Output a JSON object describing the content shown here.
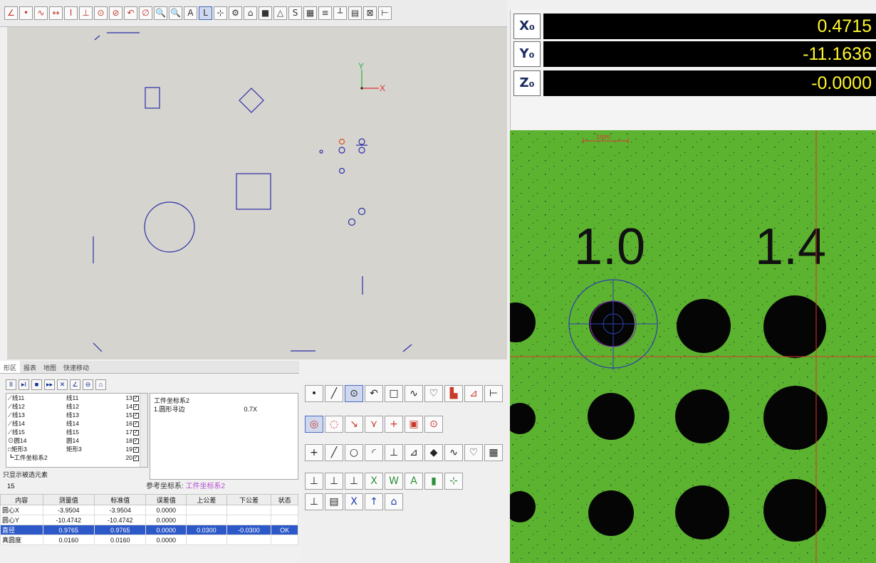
{
  "toolbar": {
    "icons": [
      "∠",
      "•",
      "∿",
      "↔",
      "I",
      "⊥",
      "⊙",
      "⊘",
      "↶",
      "∅",
      "🔍",
      "🔍",
      "A",
      "L",
      "⊹",
      "⚙",
      "⌂",
      "■",
      "△",
      "S",
      "▦",
      "≡",
      "┴",
      "▤",
      "⊠",
      "⊢"
    ]
  },
  "axes": {
    "x_label": "X",
    "y_label": "Y"
  },
  "dro": {
    "x_label": "X₀",
    "x_value": "0.4715",
    "y_label": "Y₀",
    "y_value": "-11.1636",
    "z_label": "Z₀",
    "z_value": "-0.0000"
  },
  "camera": {
    "scale_label": "1mm",
    "label_a": "1.0",
    "label_b": "1.4"
  },
  "tabs": [
    "形区",
    "报表",
    "地图",
    "快速移动"
  ],
  "controls": [
    "II",
    "▸I",
    "■",
    "▸▸",
    "✕",
    "∠",
    "⊖",
    "⌂"
  ],
  "features": [
    {
      "name": "⟋线11",
      "orig": "线11",
      "count": "13"
    },
    {
      "name": "⟋线12",
      "orig": "线12",
      "count": "14"
    },
    {
      "name": "⟋线13",
      "orig": "线13",
      "count": "15"
    },
    {
      "name": "⟋线14",
      "orig": "线14",
      "count": "16"
    },
    {
      "name": "⟋线15",
      "orig": "线15",
      "count": "17"
    },
    {
      "name": "⊙圆14",
      "orig": "圆14",
      "count": "18"
    },
    {
      "name": "□矩形3",
      "orig": "矩形3",
      "count": "19"
    },
    {
      "name": "┗工件坐标系2",
      "orig": "",
      "count": "20"
    }
  ],
  "feature_footer": "只显示被选元素",
  "info": {
    "title": "工件坐标系2",
    "line1_label": "1.圆形寻边",
    "line1_value": "0.7X"
  },
  "results": {
    "count": "15",
    "ref_label": "参考坐标系:",
    "ref_value": "工件坐标系2",
    "headers": [
      "内容",
      "测量值",
      "标准值",
      "误差值",
      "上公差",
      "下公差",
      "状态"
    ],
    "rows": [
      [
        "圆心X",
        "-3.9504",
        "-3.9504",
        "0.0000",
        "",
        "",
        ""
      ],
      [
        "圆心Y",
        "-10.4742",
        "-10.4742",
        "0.0000",
        "",
        "",
        ""
      ],
      [
        "直径",
        "0.9765",
        "0.9765",
        "0.0000",
        "0.0300",
        "-0.0300",
        "OK"
      ],
      [
        "真圆度",
        "0.0160",
        "0.0160",
        "0.0000",
        "",
        "",
        ""
      ]
    ]
  },
  "tools": {
    "row1": [
      "•",
      "╱",
      "⊙",
      "↶",
      "□",
      "∿",
      "♡",
      "▙",
      "⊿",
      "⊢"
    ],
    "row2": [
      "◎",
      "◌",
      "↘",
      "⋎",
      "+",
      "▣",
      "⊙"
    ],
    "row3": [
      "+",
      "╱",
      "○",
      "◜",
      "⊥",
      "⊿",
      "◆",
      "∿",
      "♡",
      "▦"
    ],
    "row4": [
      "⊥",
      "⊥",
      "⊥",
      "X",
      "W",
      "A",
      "▮",
      "⊹"
    ],
    "row5": [
      "⊥",
      "▤",
      "X",
      "↑",
      "⌂"
    ]
  }
}
